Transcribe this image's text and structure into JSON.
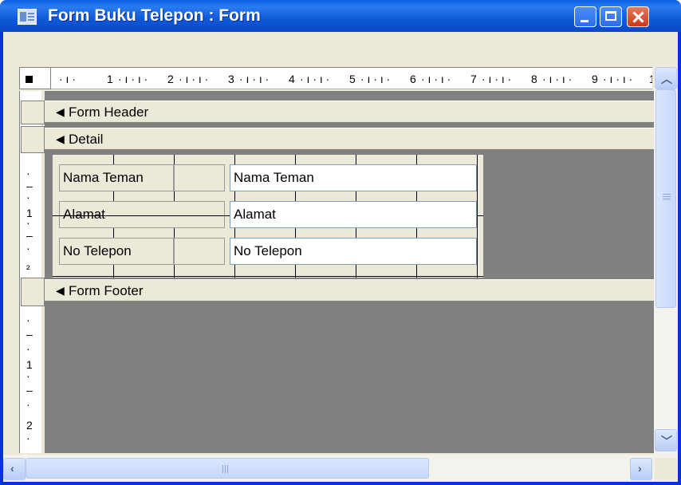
{
  "window": {
    "title": "Form Buku Telepon : Form",
    "title_color": "#0831d9"
  },
  "ruler": {
    "horizontal_labels": [
      "1",
      "2",
      "3",
      "4",
      "5",
      "6",
      "7",
      "8",
      "9",
      "1"
    ],
    "vertical_labels": [
      "1",
      "2",
      "1",
      "2"
    ]
  },
  "sections": {
    "header": "Form Header",
    "detail": "Detail",
    "footer": "Form Footer"
  },
  "fields": [
    {
      "label": "Nama Teman",
      "textbox": "Nama Teman"
    },
    {
      "label": "Alamat",
      "textbox": "Alamat"
    },
    {
      "label": "No Telepon",
      "textbox": "No Telepon"
    }
  ],
  "colors": {
    "design_background": "#808080",
    "section_bar": "#ece9d8",
    "textbox_background": "#ffffff"
  },
  "icons": {
    "window": "form-icon",
    "minimize": "minimize-icon",
    "maximize": "maximize-icon",
    "close": "close-icon",
    "section_arrow": "section-collapse-icon"
  }
}
